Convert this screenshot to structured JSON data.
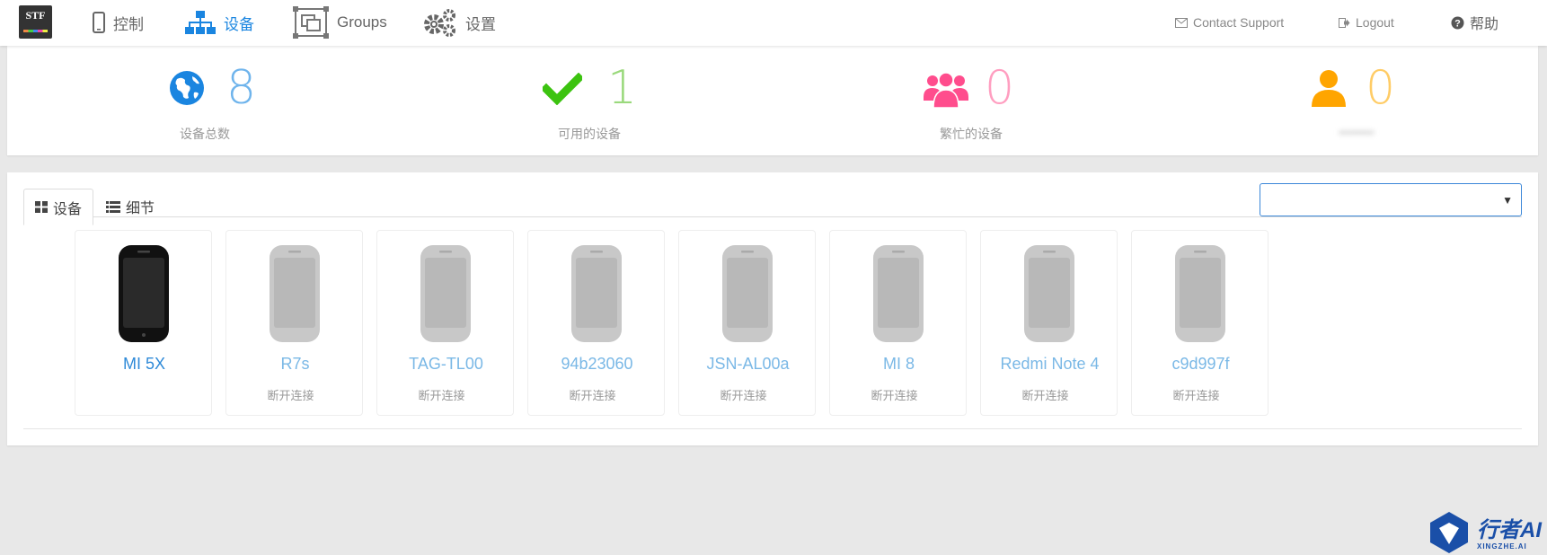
{
  "nav": {
    "logo": "STF",
    "items": [
      {
        "label": "控制",
        "icon": "mobile-icon"
      },
      {
        "label": "设备",
        "icon": "sitemap-icon"
      },
      {
        "label": "Groups",
        "icon": "groups-icon"
      },
      {
        "label": "设置",
        "icon": "gears-icon"
      }
    ],
    "active": "设备",
    "contact_support": "Contact Support",
    "logout": "Logout",
    "help": "帮助"
  },
  "stats": [
    {
      "value": "8",
      "label": "设备总数",
      "icon": "globe-icon",
      "color": "#1a85e0",
      "num_color": "#6fb4ec"
    },
    {
      "value": "1",
      "label": "可用的设备",
      "icon": "check-icon",
      "color": "#3cc310",
      "num_color": "#9ad97c"
    },
    {
      "value": "0",
      "label": "繁忙的设备",
      "icon": "users-icon",
      "color": "#ff4d8d",
      "num_color": "#ff9ec0"
    },
    {
      "value": "0",
      "label": "••••••••",
      "icon": "user-icon",
      "color": "#ffa500",
      "num_color": "#ffcc66"
    }
  ],
  "tabs": [
    {
      "label": "设备",
      "icon": "th-large-icon"
    },
    {
      "label": "细节",
      "icon": "list-icon"
    }
  ],
  "filter_select": {
    "value": ""
  },
  "devices": [
    {
      "name": "MI 5X",
      "status": "",
      "online": true
    },
    {
      "name": "R7s",
      "status": "断开连接",
      "online": false
    },
    {
      "name": "TAG-TL00",
      "status": "断开连接",
      "online": false
    },
    {
      "name": "94b23060",
      "status": "断开连接",
      "online": false
    },
    {
      "name": "JSN-AL00a",
      "status": "断开连接",
      "online": false
    },
    {
      "name": "MI 8",
      "status": "断开连接",
      "online": false
    },
    {
      "name": "Redmi Note 4",
      "status": "断开连接",
      "online": false
    },
    {
      "name": "c9d997f",
      "status": "断开连接",
      "online": false
    }
  ],
  "watermark": {
    "title": "行者AI",
    "subtitle": "XINGZHE.AI"
  }
}
